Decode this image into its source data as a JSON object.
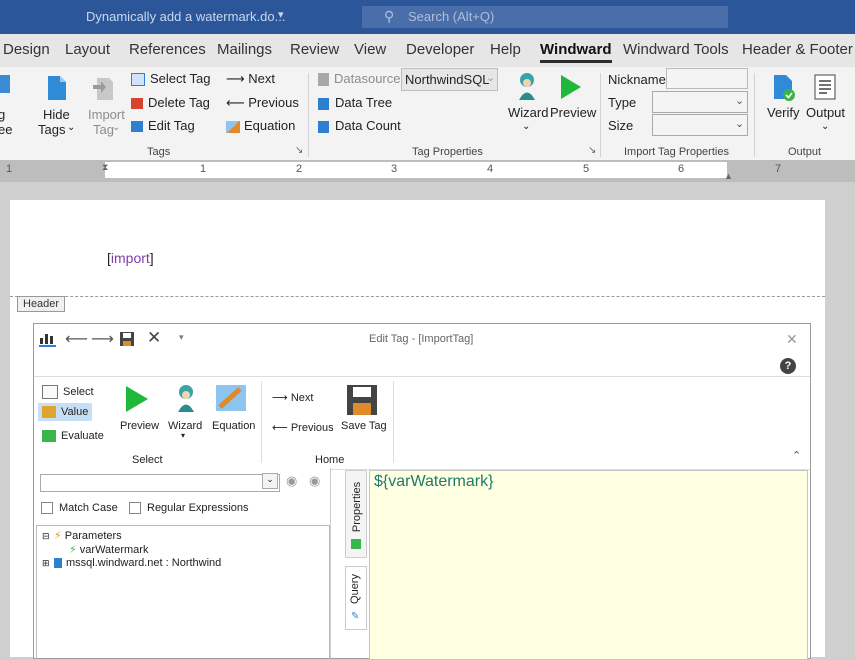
{
  "titlebar": {
    "doc_title": "Dynamically add a watermark.do...",
    "search_placeholder": "Search (Alt+Q)"
  },
  "tabs": [
    "Design",
    "Layout",
    "References",
    "Mailings",
    "Review",
    "View",
    "Developer",
    "Help",
    "Windward",
    "Windward Tools",
    "Header & Footer"
  ],
  "active_tab": "Windward",
  "ribbon": {
    "hide_tags": "Hide",
    "hide_tags2": "Tags",
    "import_tag": "Import",
    "import_tag2": "Tag",
    "select_tag": "Select Tag",
    "delete_tag": "Delete Tag",
    "edit_tag": "Edit Tag",
    "next": "Next",
    "previous": "Previous",
    "equation": "Equation",
    "group_tags": "Tags",
    "datasource": "Datasource",
    "datasource_value": "NorthwindSQL",
    "data_tree": "Data Tree",
    "data_count": "Data Count",
    "wizard": "Wizard",
    "preview": "Preview",
    "group_tag_properties": "Tag Properties",
    "nickname": "Nickname",
    "type": "Type",
    "size": "Size",
    "group_import_tag_properties": "Import Tag Properties",
    "verify": "Verify",
    "output": "Output",
    "group_output": "Output"
  },
  "ruler": [
    "1",
    "1",
    "2",
    "3",
    "4",
    "5",
    "6",
    "7"
  ],
  "document": {
    "import_open": "[",
    "import_text": "import",
    "import_close": "]",
    "header_label": "Header"
  },
  "dialog": {
    "title": "Edit Tag - [ImportTag]",
    "select": "Select",
    "value": "Value",
    "evaluate": "Evaluate",
    "preview": "Preview",
    "wizard": "Wizard",
    "equation": "Equation",
    "group_select": "Select",
    "next": "Next",
    "previous": "Previous",
    "save_tag": "Save Tag",
    "group_home": "Home",
    "match_case": "Match Case",
    "regular_expressions": "Regular Expressions",
    "tree": {
      "parameters": "Parameters",
      "var_watermark": "varWatermark",
      "datasource": "mssql.windward.net : Northwind"
    },
    "tab_properties": "Properties",
    "tab_query": "Query",
    "editor_text": "${varWatermark}"
  },
  "colors": {
    "titlebar": "#2b579a",
    "editor_bg": "#ffffe1",
    "code_text": "#1d7a6c",
    "preview_green": "#1fb83a"
  }
}
